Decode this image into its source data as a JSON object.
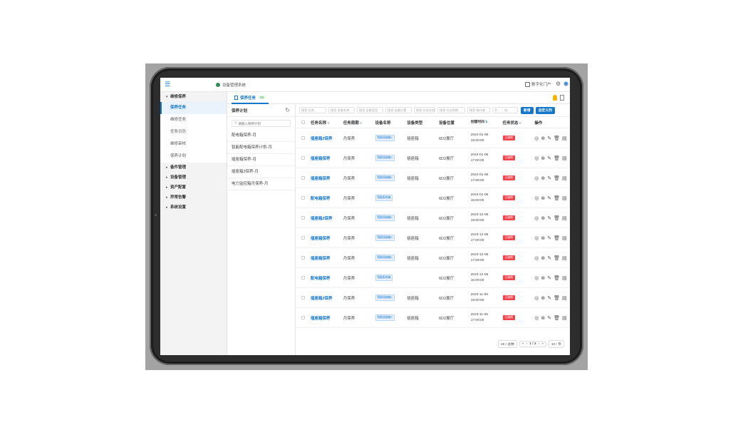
{
  "app": {
    "title": "设备管理系统",
    "portal": "数字化门户"
  },
  "sidebar": {
    "groups": [
      {
        "label": "维修保养",
        "expanded": true
      },
      {
        "label": "备件管理"
      },
      {
        "label": "设备管理"
      },
      {
        "label": "资产配置"
      },
      {
        "label": "异常告警"
      },
      {
        "label": "系统设置"
      }
    ],
    "sub_items": [
      "保养任务",
      "维修任务",
      "任务日历",
      "维修审核",
      "保养计划"
    ]
  },
  "tab": {
    "label": "保养任务",
    "badge": "28"
  },
  "plan_panel": {
    "title": "保养计划",
    "search_placeholder": "请输入保养计划",
    "items": [
      "配电箱保养-月",
      "智能配电箱保养计划-月",
      "插座箱保养-月",
      "插座箱2保养-月",
      "电力监控箱月保养-月"
    ]
  },
  "filters": {
    "name": "搜索 任务...",
    "dev": "搜索 设备名称",
    "devtype": "搜索 设备类型",
    "pos": "搜索 设备位置",
    "status": "搜索 任务状态",
    "date": "搜索 任务周期",
    "type": "搜索 操作者",
    "more": "开... → 结..."
  },
  "buttons": {
    "new": "新增",
    "custom": "自定义列"
  },
  "columns": [
    "任务名称",
    "任务周期",
    "设备名称",
    "设备类型",
    "设备位置",
    "创建时间",
    "任务状态",
    "操作"
  ],
  "rows": [
    {
      "name": "插座箱2保养",
      "cycle": "月保养",
      "device": "智能插座箱C",
      "type": "插座箱",
      "location": "6D2展厅",
      "date": "2024-01-06",
      "time": "18:00:00",
      "status": "已逾期"
    },
    {
      "name": "插座箱保养",
      "cycle": "月保养",
      "device": "智能插座箱C",
      "type": "插座箱",
      "location": "6D2展厅",
      "date": "2024-01-06",
      "time": "17:00:00",
      "status": "已逾期"
    },
    {
      "name": "插座箱保养",
      "cycle": "月保养",
      "device": "智能插座箱C",
      "type": "插座箱",
      "location": "6D2展厅",
      "date": "2024-01-06",
      "time": "17:00:00",
      "status": "已逾期"
    },
    {
      "name": "配电箱保养",
      "cycle": "月保养",
      "device": "智能配电箱",
      "type": "",
      "location": "6D2展厅",
      "date": "2024-01-06",
      "time": "15:00:00",
      "status": "已逾期"
    },
    {
      "name": "插座箱2保养",
      "cycle": "月保养",
      "device": "智能插座箱C",
      "type": "插座箱",
      "location": "6D2展厅",
      "date": "2023-12-06",
      "time": "18:00:00",
      "status": "已逾期"
    },
    {
      "name": "插座箱保养",
      "cycle": "月保养",
      "device": "智能插座箱C",
      "type": "插座箱",
      "location": "6D2展厅",
      "date": "2023-12-06",
      "time": "17:00:00",
      "status": "已逾期"
    },
    {
      "name": "插座箱保养",
      "cycle": "月保养",
      "device": "智能插座箱C",
      "type": "插座箱",
      "location": "6D2展厅",
      "date": "2023-12-06",
      "time": "17:00:00",
      "status": "已逾期"
    },
    {
      "name": "配电箱保养",
      "cycle": "月保养",
      "device": "智能配电箱",
      "type": "",
      "location": "6D2展厅",
      "date": "2023-12-06",
      "time": "15:00:00",
      "status": "已逾期"
    },
    {
      "name": "插座箱2保养",
      "cycle": "月保养",
      "device": "智能插座箱C",
      "type": "插座箱",
      "location": "6D2展厅",
      "date": "2023-11-06",
      "time": "18:00:00",
      "status": "已逾期"
    },
    {
      "name": "插座箱保养",
      "cycle": "月保养",
      "device": "智能插座箱C",
      "type": "插座箱",
      "location": "6D2展厅",
      "date": "2023-11-06",
      "time": "17:00:00",
      "status": "已逾期"
    }
  ],
  "pagination": {
    "total": "28 / 总数",
    "page": "1 / 3",
    "size": "10 / 页"
  },
  "colors": {
    "accent": "#1677c9",
    "danger": "#f0434a",
    "badge_green": "#3aa55a"
  }
}
